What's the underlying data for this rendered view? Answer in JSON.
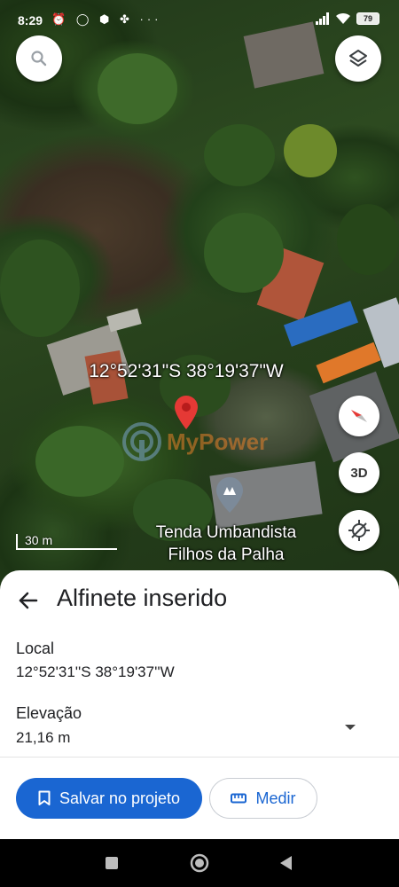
{
  "status_bar": {
    "time": "8:29",
    "icons": [
      "alarm-icon",
      "whatsapp-icon",
      "app-icon",
      "fan-icon",
      "more-icon"
    ],
    "battery": "79"
  },
  "map": {
    "search_icon": "search-icon",
    "layers_icon": "layers-icon",
    "pin_coordinates": "12°52'31\"S 38°19'37\"W",
    "place_name_line1": "Tenda Umbandista",
    "place_name_line2": "Filhos da Palha",
    "scale": "30 m",
    "view_3d_label": "3D",
    "pin_color": "#e53935",
    "watermark_text": "MyPower"
  },
  "sheet": {
    "title": "Alfinete inserido",
    "local_label": "Local",
    "local_value": "12°52'31''S 38°19'37''W",
    "elevation_label": "Elevação",
    "elevation_value": "21,16 m",
    "save_button": "Salvar no projeto",
    "measure_button": "Medir",
    "accent_color": "#1a66d2"
  }
}
